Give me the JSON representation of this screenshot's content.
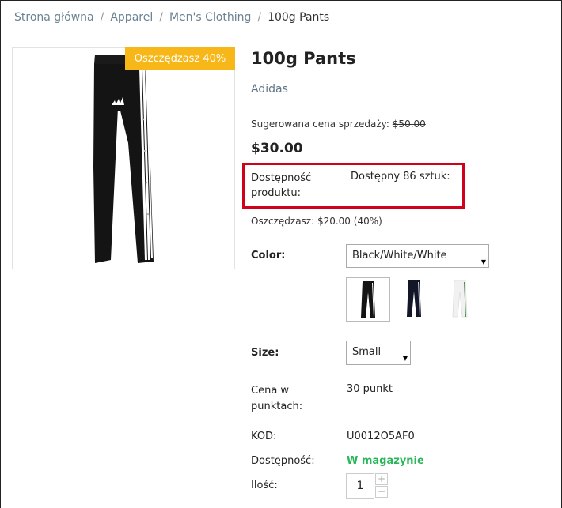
{
  "breadcrumb": {
    "items": [
      "Strona główna",
      "Apparel",
      "Men's Clothing"
    ],
    "separator": "/",
    "current": "100g Pants"
  },
  "product": {
    "badge": "Oszczędzasz 40%",
    "title": "100g Pants",
    "brand": "Adidas",
    "msrp_label": "Sugerowana cena sprzedaży:",
    "msrp_value": "$50.00",
    "price": "$30.00",
    "availability_label": "Dostępność produktu:",
    "availability_value": "Dostępny 86 sztuk:",
    "savings": "Oszczędzasz: $20.00 (40%)"
  },
  "options": {
    "color_label": "Color:",
    "color_value": "Black/White/White",
    "swatches": [
      "Black/White/White",
      "Black/Blue",
      "White"
    ],
    "size_label": "Size:",
    "size_value": "Small"
  },
  "details": {
    "points_label": "Cena w punktach:",
    "points_value": "30 punkt",
    "code_label": "KOD:",
    "code_value": "U0012O5AF0",
    "stock_label": "Dostępność:",
    "stock_value": "W magazynie",
    "qty_label": "Ilość:",
    "qty_value": "1",
    "plus": "+",
    "minus": "−"
  },
  "colors": {
    "badge_bg": "#f7b718",
    "highlight_border": "#d0021b",
    "in_stock": "#2ab65a",
    "link": "#6a8294"
  }
}
